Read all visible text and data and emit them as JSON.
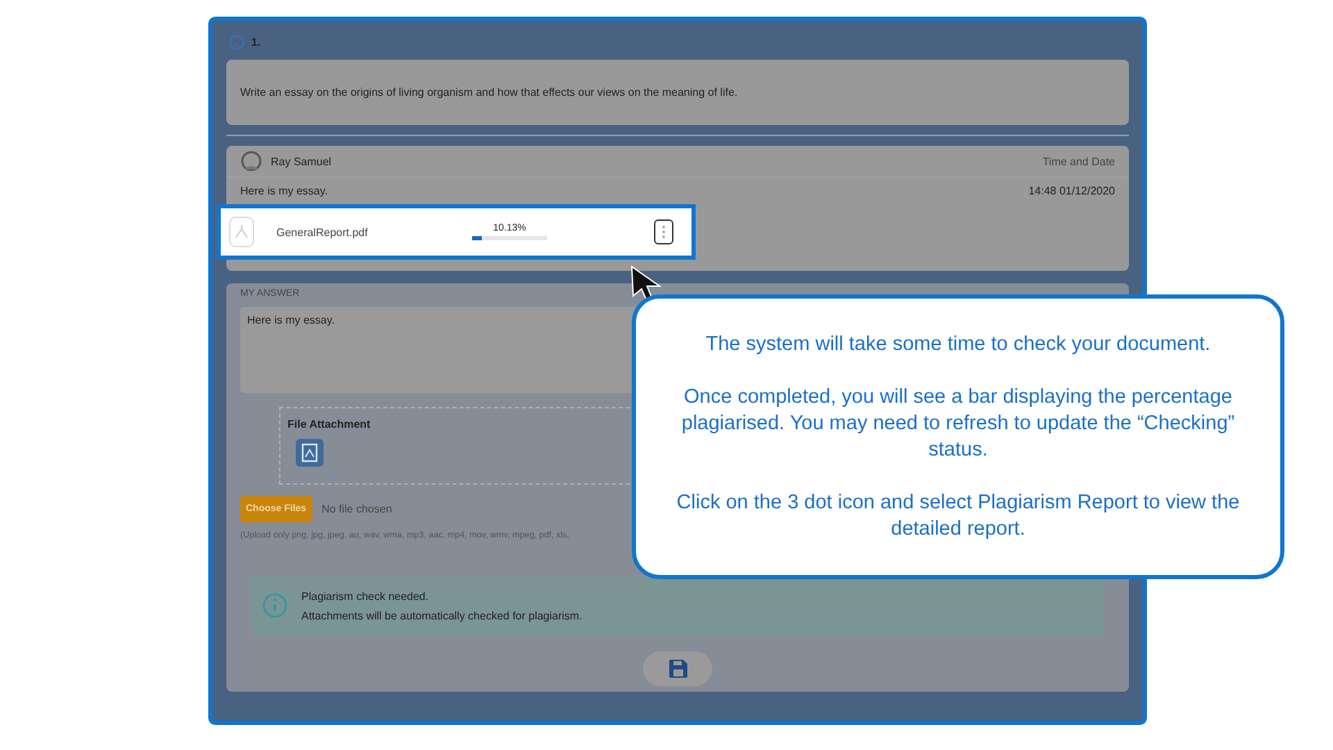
{
  "question": {
    "number": "1.",
    "text": "Write an essay on the origins of living organism and how that effects our views on the meaning of life."
  },
  "response": {
    "author": "Ray Samuel",
    "date_heading": "Time and Date",
    "message": "Here is my essay.",
    "timestamp": "14:48 01/12/2020",
    "attachment": {
      "file_name": "GeneralReport.pdf",
      "percent": "10.13%",
      "level": 0.13,
      "highlighted": true
    }
  },
  "answer": {
    "heading": "MY ANSWER",
    "value": "Here is my essay.",
    "attachment_label": "File Attachment",
    "choose_button": "Choose Files",
    "no_file": "No file chosen",
    "upload_hint": "(Upload only png, jpg, jpeg, au, wav, wma, mp3, aac, mp4, mov, wmv, mpeg, pdf, xls,",
    "notice": [
      "Plagiarism check needed.",
      "Attachments will be automatically checked for plagiarism."
    ]
  },
  "callout": [
    "The system will take some time to check your document.",
    "Once completed, you will see a bar displaying the percentage plagiarised. You may need to refresh to update the “Checking” status.",
    "Click on the 3 dot icon and select Plagiarism Report to view the detailed report."
  ]
}
